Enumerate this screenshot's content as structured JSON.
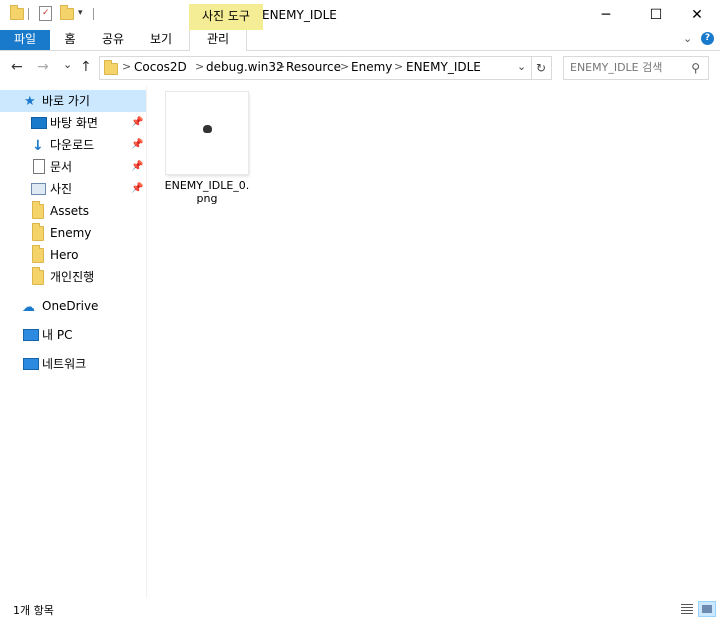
{
  "titlebar": {
    "context_tab_header": "사진 도구",
    "window_title": "ENEMY_IDLE",
    "minimize": "─",
    "maximize": "☐",
    "close": "✕"
  },
  "ribbon": {
    "tabs": [
      {
        "label": "파일"
      },
      {
        "label": "홈"
      },
      {
        "label": "공유"
      },
      {
        "label": "보기"
      },
      {
        "label": "관리"
      }
    ]
  },
  "nav": {
    "back": "←",
    "forward": "→",
    "recent": "⌄",
    "up": "↑"
  },
  "address": {
    "crumbs": [
      "Cocos2D",
      "debug.win32",
      "Resource",
      "Enemy",
      "ENEMY_IDLE"
    ],
    "separator": ">",
    "dropdown": "⌄",
    "refresh": "↻"
  },
  "search": {
    "placeholder": "ENEMY_IDLE 검색",
    "icon": "search-icon"
  },
  "sidebar": {
    "quick_access": "바로 가기",
    "items": [
      {
        "label": "바탕 화면",
        "icon": "desktop-icon",
        "pinned": true
      },
      {
        "label": "다운로드",
        "icon": "download-icon",
        "pinned": true
      },
      {
        "label": "문서",
        "icon": "document-icon",
        "pinned": true
      },
      {
        "label": "사진",
        "icon": "picture-icon",
        "pinned": true
      },
      {
        "label": "Assets",
        "icon": "folder-icon",
        "pinned": false
      },
      {
        "label": "Enemy",
        "icon": "folder-icon",
        "pinned": false
      },
      {
        "label": "Hero",
        "icon": "folder-icon",
        "pinned": false
      },
      {
        "label": "개인진행",
        "icon": "folder-icon",
        "pinned": false
      }
    ],
    "onedrive": "OneDrive",
    "this_pc": "내 PC",
    "network": "네트워크"
  },
  "files": [
    {
      "name": "ENEMY_IDLE_0.png"
    }
  ],
  "status": {
    "item_count": "1개 항목"
  },
  "colors": {
    "file_tab": "#1979ca",
    "context_tab": "#f4ed95",
    "selection": "#cce8ff"
  }
}
